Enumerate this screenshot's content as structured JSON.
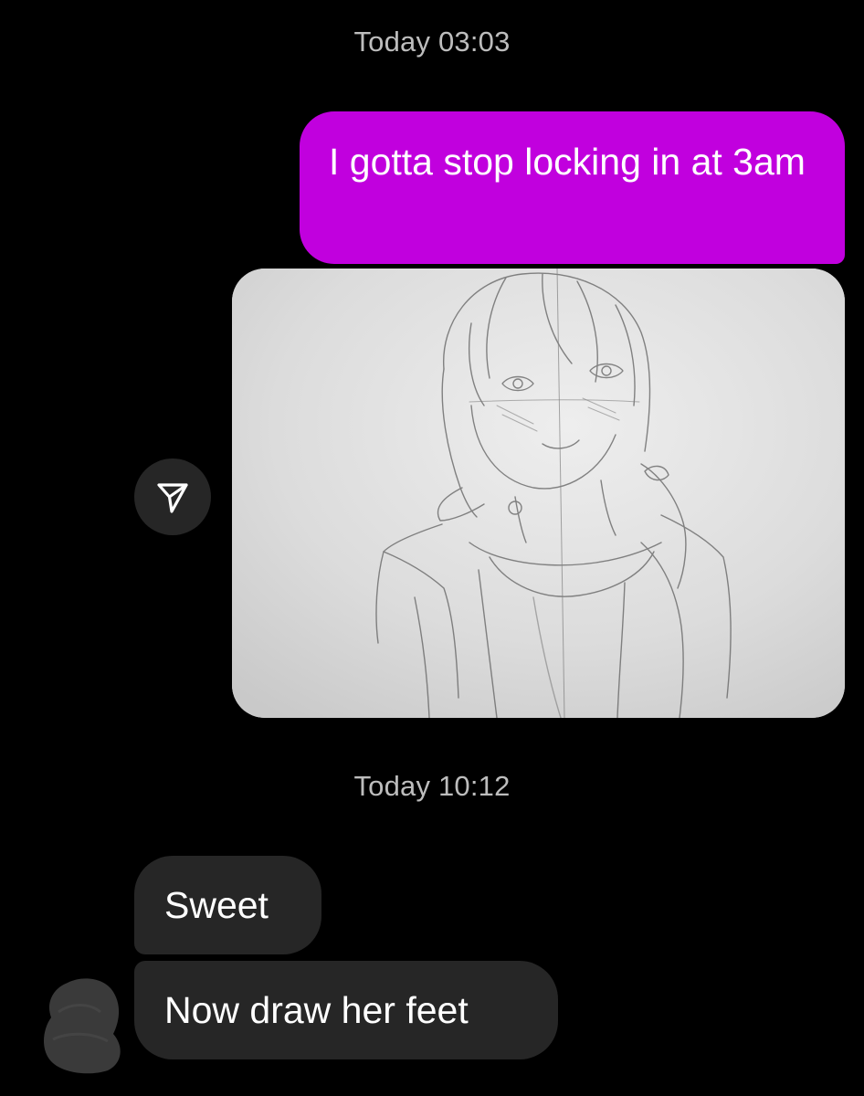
{
  "conversation": {
    "timestamps": [
      "Today 03:03",
      "Today 10:12"
    ],
    "outgoing_message": "I gotta stop locking in at 3am",
    "incoming_messages": [
      "Sweet",
      "Now draw her feet"
    ]
  },
  "colors": {
    "background": "#000000",
    "outgoing_bubble": "#c100de",
    "incoming_bubble": "#262626",
    "timestamp_text": "#bdbdbd"
  },
  "icons": {
    "share": "paper-plane-icon",
    "avatar": "redacted-avatar"
  }
}
